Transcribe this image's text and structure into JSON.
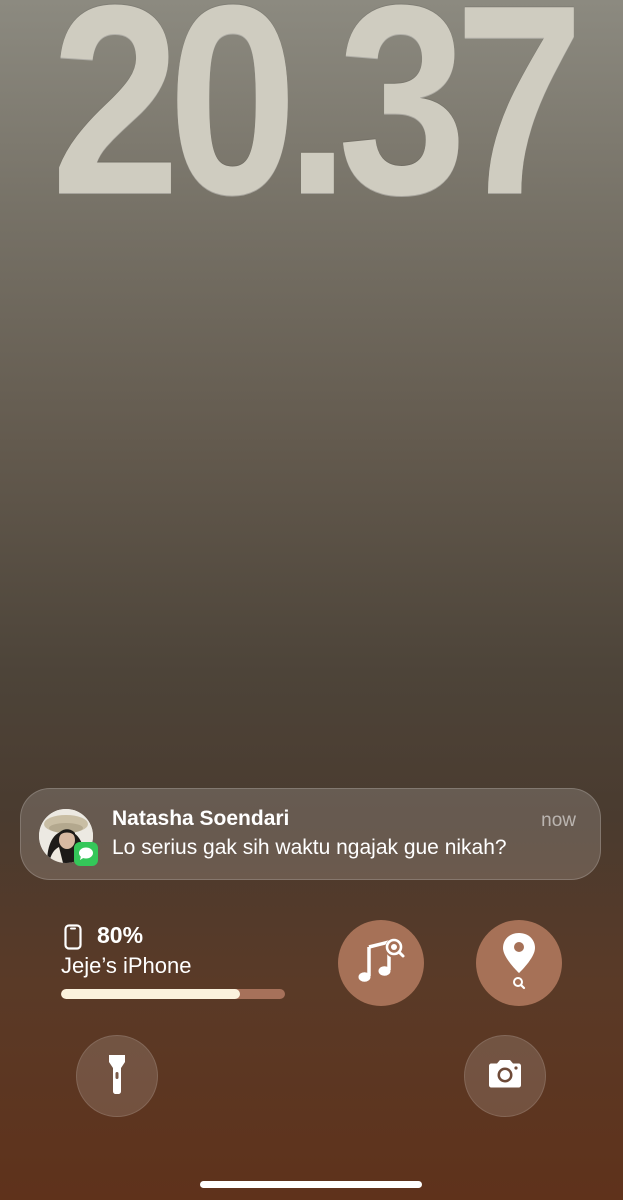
{
  "lockscreen": {
    "time": "20.37"
  },
  "notification": {
    "sender": "Natasha Soendari",
    "time": "now",
    "message": "Lo serius gak sih waktu ngajak gue nikah?",
    "app_icon": "messages-icon"
  },
  "battery_widget": {
    "percent_label": "80%",
    "level": 0.8,
    "device_name": "Jeje’s iPhone",
    "icon": "iphone-icon"
  },
  "widgets": [
    {
      "name": "music-recognition",
      "icon": "music-search-icon"
    },
    {
      "name": "find-my",
      "icon": "location-search-icon"
    }
  ],
  "quick_actions": {
    "left": {
      "icon": "flashlight-icon"
    },
    "right": {
      "icon": "camera-icon"
    }
  },
  "colors": {
    "clock": "#cfccc0",
    "widget_bg": "#a67157",
    "battery_fill": "#fbf2dd",
    "battery_track": "#a6715a",
    "messages_green": "#34c759"
  }
}
